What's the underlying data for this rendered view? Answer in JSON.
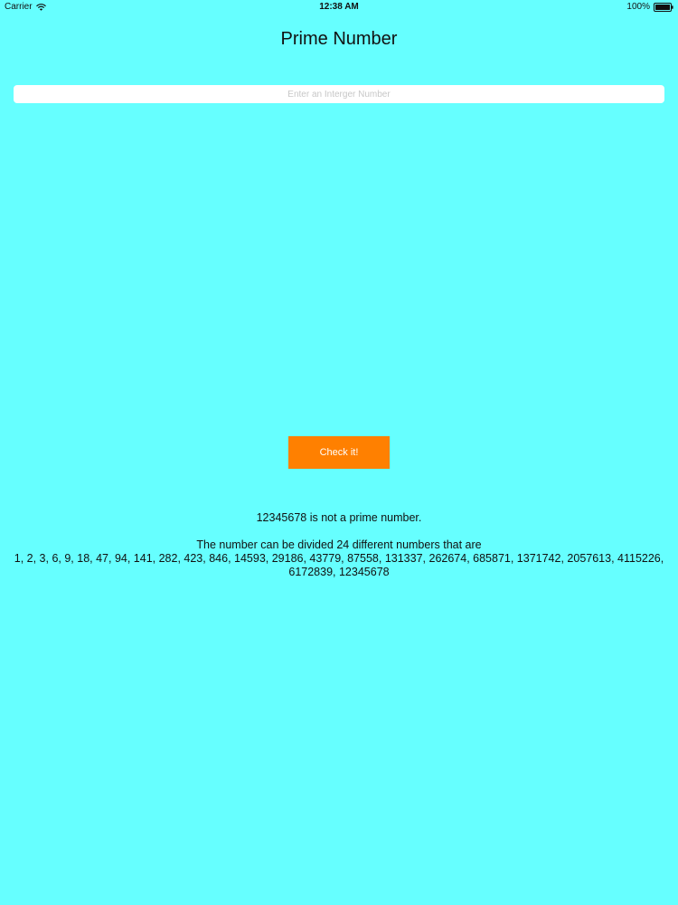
{
  "status_bar": {
    "carrier": "Carrier",
    "time": "12:38 AM",
    "battery": "100%"
  },
  "title": "Prime Number",
  "input": {
    "placeholder": "Enter an Interger Number",
    "value": ""
  },
  "button": {
    "label": "Check it!"
  },
  "result": {
    "summary": "12345678 is not a prime number.",
    "divisors_intro": "The number can be divided 24 different numbers that are",
    "divisors_line1": "1, 2, 3, 6, 9, 18, 47, 94, 141, 282, 423, 846, 14593, 29186, 43779, 87558, 131337, 262674, 685871, 1371742, 2057613, 4115226,",
    "divisors_line2": "6172839, 12345678"
  },
  "colors": {
    "background": "#66ffff",
    "button": "#ff8000"
  }
}
